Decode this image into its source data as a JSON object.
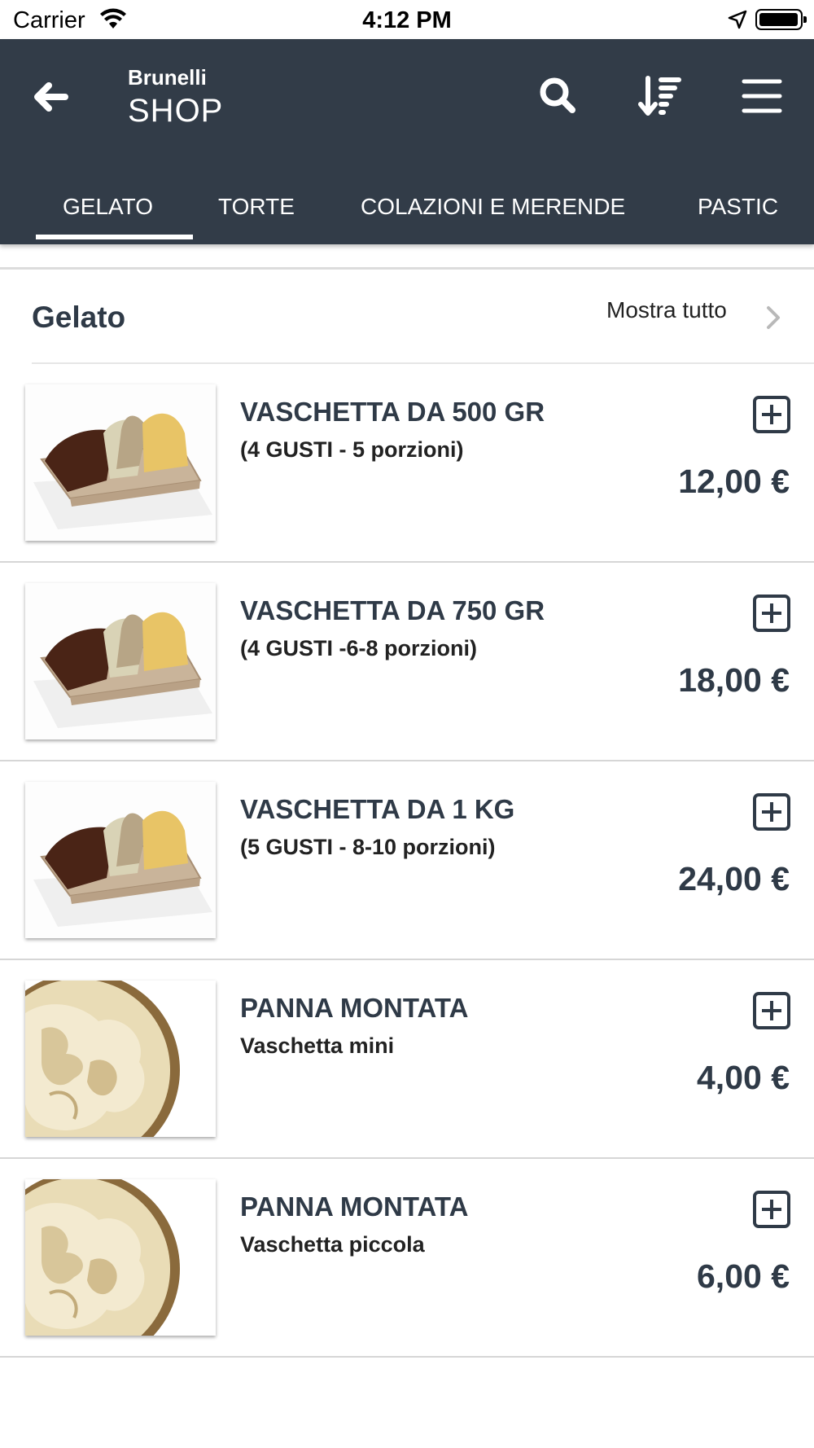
{
  "status_bar": {
    "carrier": "Carrier",
    "time": "4:12 PM"
  },
  "header": {
    "brand_small": "Brunelli",
    "brand_big": "SHOP",
    "icons": [
      "back-arrow-icon",
      "search-icon",
      "sort-icon",
      "menu-icon"
    ],
    "background_color": "#323c48"
  },
  "tabs": [
    {
      "label": "GELATO",
      "selected": true
    },
    {
      "label": "TORTE",
      "selected": false
    },
    {
      "label": "COLAZIONI E MERENDE",
      "selected": false
    },
    {
      "label": "PASTIC",
      "selected": false
    }
  ],
  "section": {
    "title": "Gelato",
    "show_all": "Mostra tutto"
  },
  "products": [
    {
      "title": "VASCHETTA DA 500 GR",
      "subtitle": "(4 GUSTI - 5 porzioni)",
      "price": "12,00 €",
      "image": "gelato-tub"
    },
    {
      "title": "VASCHETTA DA 750 GR",
      "subtitle": "(4 GUSTI -6-8 porzioni)",
      "price": "18,00 €",
      "image": "gelato-tub"
    },
    {
      "title": "VASCHETTA DA 1 KG",
      "subtitle": "(5 GUSTI - 8-10 porzioni)",
      "price": "24,00 €",
      "image": "gelato-tub"
    },
    {
      "title": "PANNA MONTATA",
      "subtitle": "Vaschetta mini",
      "price": "4,00 €",
      "image": "whipped-cream"
    },
    {
      "title": "PANNA MONTATA",
      "subtitle": "Vaschetta piccola",
      "price": "6,00 €",
      "image": "whipped-cream"
    }
  ]
}
